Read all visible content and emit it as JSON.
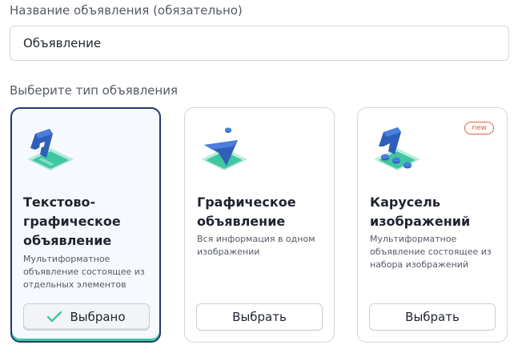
{
  "form": {
    "name_label": "Название объявления (обязательно)",
    "name_value": "Объявление",
    "type_label": "Выберите тип объявления"
  },
  "cards": [
    {
      "title": "Текстово-графическое объявление",
      "description": "Мультиформатное объявление состоящее из отдельных элементов",
      "button": "Выбрано",
      "selected": true,
      "icon": "text-graphic-ad-icon"
    },
    {
      "title": "Графическое объявление",
      "description": "Вся информация в одном изображении",
      "button": "Выбрать",
      "selected": false,
      "icon": "graphic-ad-icon"
    },
    {
      "title": "Карусель изображений",
      "description": "Мультиформатное объявление состоящее из набора изображений",
      "button": "Выбрать",
      "selected": false,
      "badge": "new",
      "icon": "carousel-ad-icon"
    }
  ],
  "colors": {
    "brand_blue": "#2f5fb8",
    "accent_green": "#3fc7a0",
    "selected_border": "#1e3a6d",
    "badge_orange": "#e8613c"
  }
}
